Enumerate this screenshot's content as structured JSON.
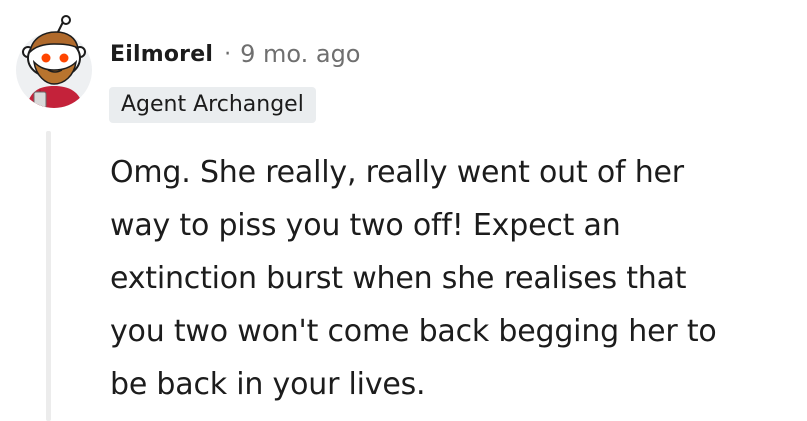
{
  "comment": {
    "avatar_icon": "snoo-avatar-icon",
    "username": "Eilmorel",
    "separator": "·",
    "timestamp": "9 mo. ago",
    "flair": "Agent Archangel",
    "body_lines": [
      "Omg. She really, really went out of her",
      "way to piss you two off! Expect an",
      "extinction burst when she realises that",
      "you two won't come back begging her to",
      "be back in your lives."
    ]
  },
  "colors": {
    "text": "#1c1c1c",
    "meta_text": "#6f6f6f",
    "flair_background": "#eaedef",
    "thread_line": "#ececec"
  }
}
